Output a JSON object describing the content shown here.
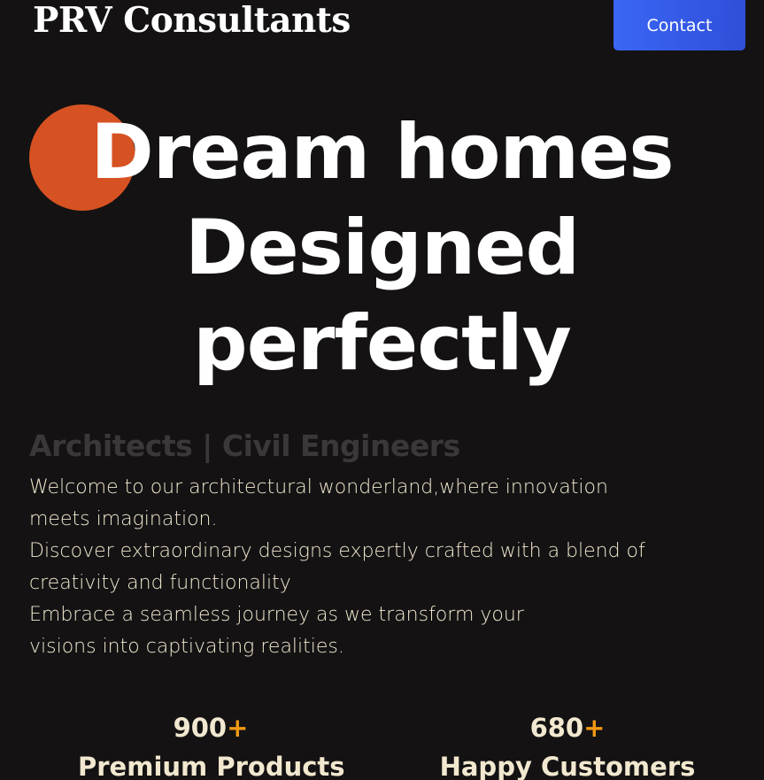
{
  "header": {
    "brand": "PRV Consultants",
    "contact_label": "Contact",
    "contact_color": "#3b66f6"
  },
  "hero": {
    "line1": "Dream homes",
    "line2": "Designed",
    "line3": "perfectly",
    "accent_color": "#d65222"
  },
  "subtitle": "Architects | Civil Engineers",
  "intro": {
    "p1": "Welcome to our architectural wonderland,where innovation",
    "p2": "meets imagination.",
    "p3": "Discover extraordinary designs expertly crafted with a blend of",
    "p4": "creativity and functionality",
    "p5": "Embrace a seamless journey as we transform your",
    "p6": "visions into captivating realities."
  },
  "stats": [
    {
      "value": "900",
      "suffix": "+",
      "label": "Premium Products"
    },
    {
      "value": "680",
      "suffix": "+",
      "label": "Happy Customers"
    }
  ]
}
